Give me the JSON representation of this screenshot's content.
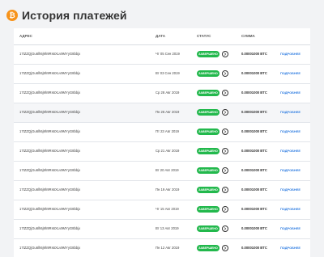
{
  "header": {
    "logo_symbol": "₿",
    "title": "История платежей"
  },
  "table": {
    "columns": {
      "address": "АДРЕС",
      "date": "ДАТА",
      "status": "СТАТУС",
      "amount": "СУММА"
    },
    "status_icon": "chevron-right-circle-icon",
    "rows": [
      {
        "address": "17tZZQjGu6lh6j9h9Rs6XLv9MYyG8bbjx",
        "date": "Чт 05 Сен 2019",
        "status": "ЗАВЕРШЕНО",
        "amount": "0.00001000 BTC",
        "details": "ПОДРОБНЕЕ"
      },
      {
        "address": "17tZZQjGu6lh6j9h9Rs6XLv9MYyG8bbjx",
        "date": "Вт 03 Сен 2019",
        "status": "ЗАВЕРШЕНО",
        "amount": "0.00001000 BTC",
        "details": "ПОДРОБНЕЕ"
      },
      {
        "address": "17tZZQjGu6lh6j9h9Rs6XLv9MYyG8bbjx",
        "date": "Ср 28 Авг 2019",
        "status": "ЗАВЕРШЕНО",
        "amount": "0.00001000 BTC",
        "details": "ПОДРОБНЕЕ"
      },
      {
        "address": "17tZZQjGu6lh6j9h9Rs6XLv9MYyG8bbjx",
        "date": "Пн 26 Авг 2019",
        "status": "ЗАВЕРШЕНО",
        "amount": "0.00001000 BTC",
        "details": "ПОДРОБНЕЕ",
        "selected": true
      },
      {
        "address": "17tZZQjGu6lh6j9h9Rs6XLv9MYyG8bbjx",
        "date": "Пт 23 Авг 2019",
        "status": "ЗАВЕРШЕНО",
        "amount": "0.00001000 BTC",
        "details": "ПОДРОБНЕЕ"
      },
      {
        "address": "17tZZQjGu6lh6j9h9Rs6XLv9MYyG8bbjx",
        "date": "Ср 21 Авг 2019",
        "status": "ЗАВЕРШЕНО",
        "amount": "0.00001000 BTC",
        "details": "ПОДРОБНЕЕ"
      },
      {
        "address": "17tZZQjGu6lh6j9h9Rs6XLv9MYyG8bbjx",
        "date": "Вт 20 Авг 2019",
        "status": "ЗАВЕРШЕНО",
        "amount": "0.00001000 BTC",
        "details": "ПОДРОБНЕЕ"
      },
      {
        "address": "17tZZQjGu6lh6j9h9Rs6XLv9MYyG8bbjx",
        "date": "Пн 19 Авг 2019",
        "status": "ЗАВЕРШЕНО",
        "amount": "0.00001000 BTC",
        "details": "ПОДРОБНЕЕ"
      },
      {
        "address": "17tZZQjGu6lh6j9h9Rs6XLv9MYyG8bbjx",
        "date": "Чт 15 Авг 2019",
        "status": "ЗАВЕРШЕНО",
        "amount": "0.00001000 BTC",
        "details": "ПОДРОБНЕЕ"
      },
      {
        "address": "17tZZQjGu6lh6j9h9Rs6XLv9MYyG8bbjx",
        "date": "Вт 13 Авг 2019",
        "status": "ЗАВЕРШЕНО",
        "amount": "0.00001000 BTC",
        "details": "ПОДРОБНЕЕ"
      },
      {
        "address": "17tZZQjGu6lh6j9h9Rs6XLv9MYyG8bbjx",
        "date": "Пн 12 Авг 2019",
        "status": "ЗАВЕРШЕНО",
        "amount": "0.00001000 BTC",
        "details": "ПОДРОБНЕЕ"
      }
    ]
  },
  "colors": {
    "background": "#f2f3f5",
    "accent": "#2f7de1",
    "status_ok": "#22b84c",
    "bitcoin": "#f7931a"
  }
}
